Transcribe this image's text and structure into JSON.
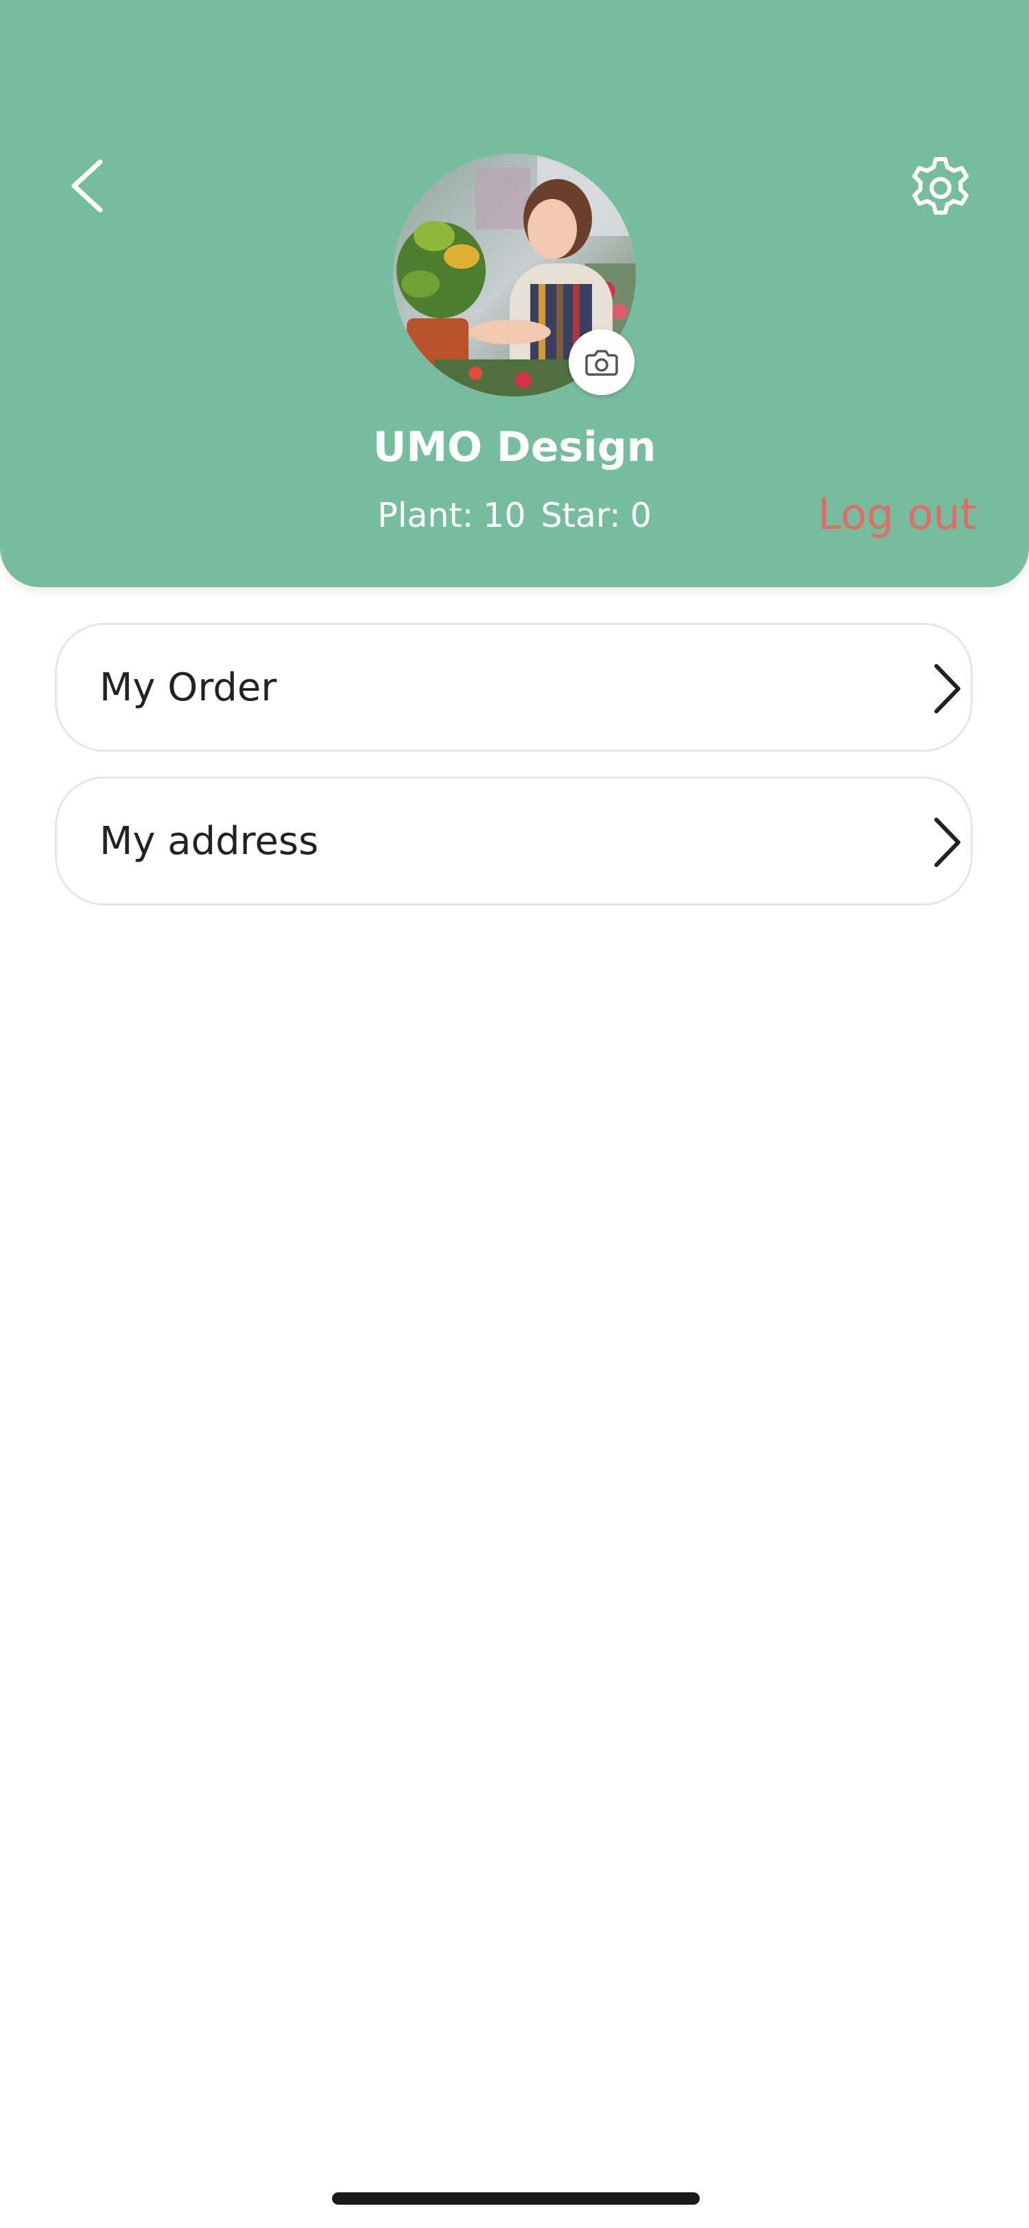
{
  "colors": {
    "header_background": "#76bc9e",
    "logout_text": "#e26b64",
    "card_border": "#e6e6e6",
    "primary_text": "#222222",
    "header_text": "#ffffff"
  },
  "header": {
    "back_icon": "chevron-left-icon",
    "settings_icon": "gear-icon",
    "avatar_alt": "profile photo",
    "camera_icon": "camera-icon",
    "user_name": "UMO Design",
    "stats": {
      "plant_label": "Plant:",
      "plant_value": "10",
      "star_label": "Star:",
      "star_value": "0"
    },
    "logout_label": "Log out"
  },
  "menu": {
    "items": [
      {
        "label": "My Order",
        "icon": "chevron-right-icon"
      },
      {
        "label": "My address",
        "icon": "chevron-right-icon"
      }
    ]
  }
}
